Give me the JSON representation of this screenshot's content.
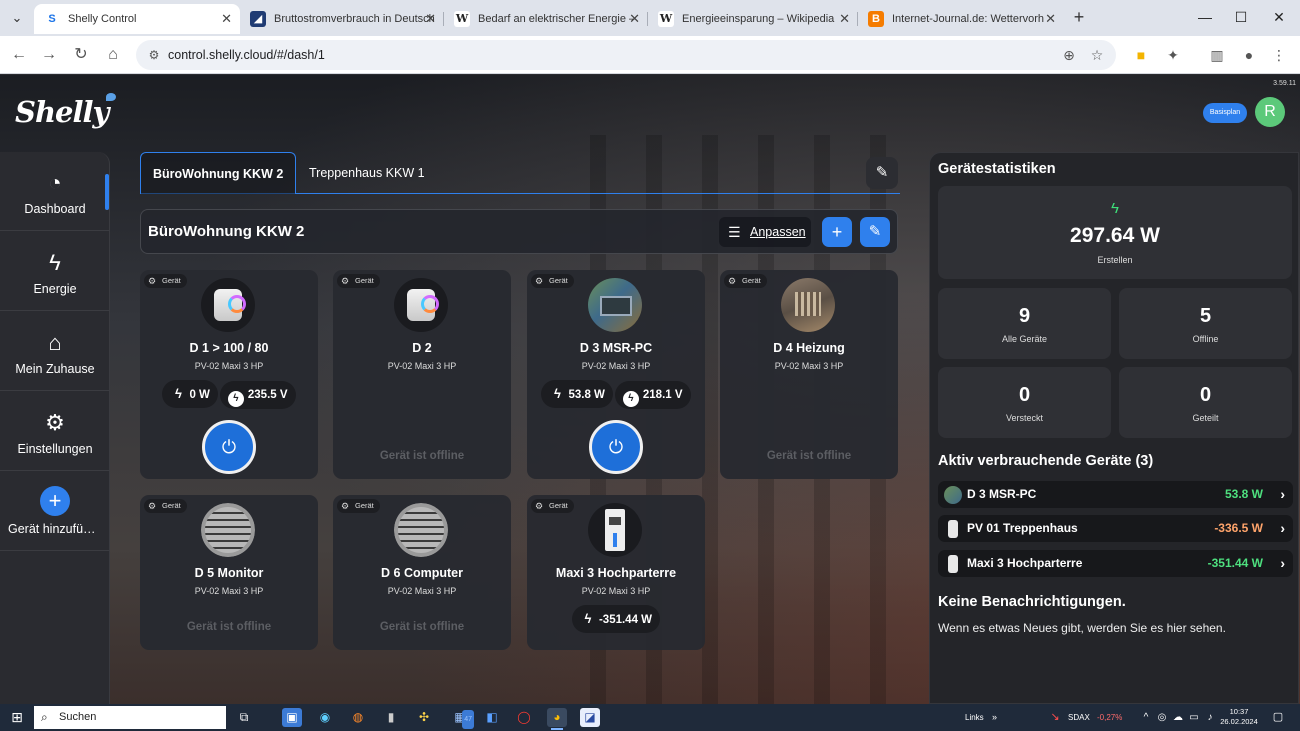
{
  "browser": {
    "tabs": [
      {
        "title": "Shelly Control",
        "favicon": "shelly-icon",
        "fav_color": "#1a73e8",
        "active": true
      },
      {
        "title": "Bruttostromverbrauch in Deutsch",
        "favicon": "stats-icon",
        "fav_color": "#1f3b73",
        "active": false
      },
      {
        "title": "Bedarf an elektrischer Energie –",
        "favicon": "wikipedia-icon",
        "fav_color": "#ffffff",
        "active": false
      },
      {
        "title": "Energieeinsparung – Wikipedia",
        "favicon": "wikipedia-icon",
        "fav_color": "#ffffff",
        "active": false
      },
      {
        "title": "Internet-Journal.de: Wettervorh",
        "favicon": "blogger-icon",
        "fav_color": "#f57c00",
        "active": false
      }
    ],
    "url": "control.shelly.cloud/#/dash/1"
  },
  "app": {
    "version": "3.59.11",
    "logo_text": "Shelly",
    "beta_pill": "Basisplan",
    "avatar_initial": "R",
    "accent": "#2f80ed"
  },
  "sidebar": {
    "items": [
      {
        "label": "Dashboard",
        "icon": "gauge-icon",
        "active": true
      },
      {
        "label": "Energie",
        "icon": "bolt-icon",
        "active": false
      },
      {
        "label": "Mein Zuhause",
        "icon": "home-icon",
        "active": false
      },
      {
        "label": "Einstellungen",
        "icon": "gear-icon",
        "active": false
      },
      {
        "label": "Gerät hinzufügen",
        "icon": "plus-icon",
        "active": false
      }
    ]
  },
  "rooms": {
    "tabs": [
      {
        "label": "BüroWohnung KKW 2",
        "active": true
      },
      {
        "label": "Treppenhaus KKW 1",
        "active": false
      }
    ],
    "current_title": "BüroWohnung KKW 2",
    "adjust_label": "Anpassen"
  },
  "devices": [
    {
      "tag": "Gerät",
      "name": "D 1 > 100 / 80",
      "model": "PV-02 Maxi 3 HP",
      "image": "plug",
      "power": "0 W",
      "voltage": "235.5 V",
      "online": true,
      "status": ""
    },
    {
      "tag": "Gerät",
      "name": "D 2",
      "model": "PV-02 Maxi 3 HP",
      "image": "plug",
      "power": "",
      "voltage": "",
      "online": false,
      "status": "Gerät ist offline"
    },
    {
      "tag": "Gerät",
      "name": "D 3 MSR-PC",
      "model": "PV-02 Maxi 3 HP",
      "image": "pc",
      "power": "53.8 W",
      "voltage": "218.1 V",
      "online": true,
      "status": ""
    },
    {
      "tag": "Gerät",
      "name": "D 4 Heizung",
      "model": "PV-02 Maxi 3 HP",
      "image": "heater",
      "power": "",
      "voltage": "",
      "online": false,
      "status": "Gerät ist offline"
    },
    {
      "tag": "Gerät",
      "name": "D 5 Monitor",
      "model": "PV-02 Maxi 3 HP",
      "image": "vent",
      "power": "",
      "voltage": "",
      "online": false,
      "status": "Gerät ist offline"
    },
    {
      "tag": "Gerät",
      "name": "D 6 Computer",
      "model": "PV-02 Maxi 3 HP",
      "image": "vent",
      "power": "",
      "voltage": "",
      "online": false,
      "status": "Gerät ist offline"
    },
    {
      "tag": "Gerät",
      "name": "Maxi 3 Hochparterre",
      "model": "PV-02 Maxi 3 HP",
      "image": "din",
      "power": "-351.44 W",
      "voltage": "",
      "online": true,
      "status": ""
    }
  ],
  "stats": {
    "title": "Gerätestatistiken",
    "produce_value": "297.64 W",
    "produce_label": "Erstellen",
    "all_devices": {
      "value": "9",
      "label": "Alle Geräte"
    },
    "offline": {
      "value": "5",
      "label": "Offline"
    },
    "hidden": {
      "value": "0",
      "label": "Versteckt"
    },
    "shared": {
      "value": "0",
      "label": "Geteilt"
    }
  },
  "active_devices": {
    "title": "Aktiv verbrauchende Geräte (3)",
    "items": [
      {
        "name": "D 3 MSR-PC",
        "value": "53.8 W",
        "tone": "green"
      },
      {
        "name": "PV 01 Treppenhaus",
        "value": "-336.5 W",
        "tone": "orange"
      },
      {
        "name": "Maxi 3 Hochparterre",
        "value": "-351.44 W",
        "tone": "green"
      }
    ]
  },
  "notifications": {
    "title": "Keine Benachrichtigungen.",
    "subtitle": "Wenn es etwas Neues gibt, werden Sie es hier sehen."
  },
  "taskbar": {
    "search_placeholder": "Suchen",
    "badge_count": "47",
    "tray_links": "Links",
    "ticker_name": "SDAX",
    "ticker_value": "-0,27%",
    "time": "10:37",
    "date": "26.02.2024"
  }
}
